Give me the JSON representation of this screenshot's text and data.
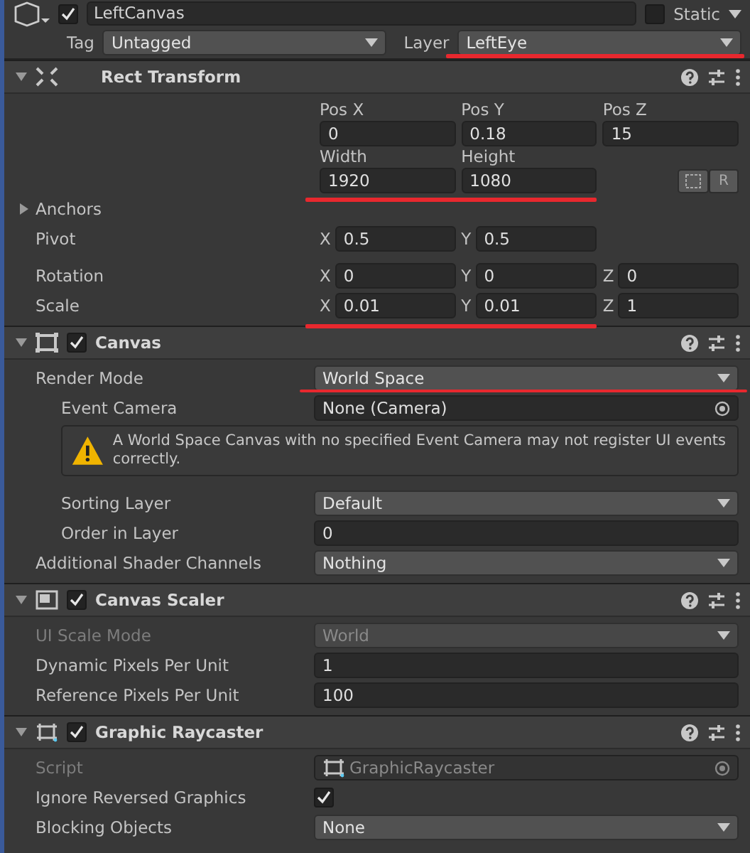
{
  "object": {
    "name": "LeftCanvas",
    "active": true,
    "static_label": "Static",
    "static": false,
    "tag_label": "Tag",
    "tag": "Untagged",
    "layer_label": "Layer",
    "layer": "LeftEye",
    "layer_underlined": true
  },
  "rect_transform": {
    "title": "Rect Transform",
    "expanded": true,
    "pos": [
      {
        "label": "Pos X",
        "value": "0"
      },
      {
        "label": "Pos Y",
        "value": "0.18"
      },
      {
        "label": "Pos Z",
        "value": "15"
      }
    ],
    "size": [
      {
        "label": "Width",
        "value": "1920"
      },
      {
        "label": "Height",
        "value": "1080"
      }
    ],
    "size_underlined": true,
    "raw_button": "R",
    "anchors": {
      "label": "Anchors",
      "expanded": false
    },
    "vectors": [
      {
        "label": "Pivot",
        "underlined": false,
        "axes": [
          {
            "axis": "X",
            "value": "0.5"
          },
          {
            "axis": "Y",
            "value": "0.5"
          }
        ]
      },
      {
        "label": "Rotation",
        "underlined": false,
        "axes": [
          {
            "axis": "X",
            "value": "0"
          },
          {
            "axis": "Y",
            "value": "0"
          },
          {
            "axis": "Z",
            "value": "0"
          }
        ]
      },
      {
        "label": "Scale",
        "underlined": true,
        "axes": [
          {
            "axis": "X",
            "value": "0.01"
          },
          {
            "axis": "Y",
            "value": "0.01"
          },
          {
            "axis": "Z",
            "value": "1"
          }
        ]
      }
    ]
  },
  "components": [
    {
      "kind": "canvas",
      "title": "Canvas",
      "enabled": true,
      "expanded": true,
      "rows": [
        {
          "kind": "dropdown",
          "label": "Render Mode",
          "value": "World Space",
          "disabled": false,
          "underlined": true,
          "children": [
            {
              "kind": "object",
              "label": "Event Camera",
              "value": "None (Camera)",
              "disabled": false,
              "underlined": false
            },
            {
              "kind": "warning",
              "text": "A World Space Canvas with no specified Event Camera may not register UI events correctly."
            },
            {
              "kind": "dropdown",
              "label": "Sorting Layer",
              "value": "Default",
              "disabled": false,
              "underlined": false
            },
            {
              "kind": "field",
              "label": "Order in Layer",
              "value": "0",
              "disabled": false,
              "underlined": false
            }
          ]
        },
        {
          "kind": "dropdown",
          "label": "Additional Shader Channels",
          "value": "Nothing",
          "disabled": false,
          "underlined": false
        }
      ]
    },
    {
      "kind": "scaler",
      "title": "Canvas Scaler",
      "enabled": true,
      "expanded": true,
      "rows": [
        {
          "kind": "dropdown",
          "label": "UI Scale Mode",
          "value": "World",
          "disabled": true,
          "underlined": false
        },
        {
          "kind": "field",
          "label": "Dynamic Pixels Per Unit",
          "value": "1",
          "disabled": false,
          "underlined": false
        },
        {
          "kind": "field",
          "label": "Reference Pixels Per Unit",
          "value": "100",
          "disabled": false,
          "underlined": false
        }
      ]
    },
    {
      "kind": "raycaster",
      "title": "Graphic Raycaster",
      "enabled": true,
      "expanded": true,
      "rows": [
        {
          "kind": "script",
          "label": "Script",
          "value": "GraphicRaycaster",
          "disabled": true,
          "underlined": false
        },
        {
          "kind": "checkbox",
          "label": "Ignore Reversed Graphics",
          "checked": true,
          "disabled": false
        },
        {
          "kind": "dropdown",
          "label": "Blocking Objects",
          "value": "None",
          "disabled": false,
          "underlined": false
        }
      ]
    }
  ]
}
